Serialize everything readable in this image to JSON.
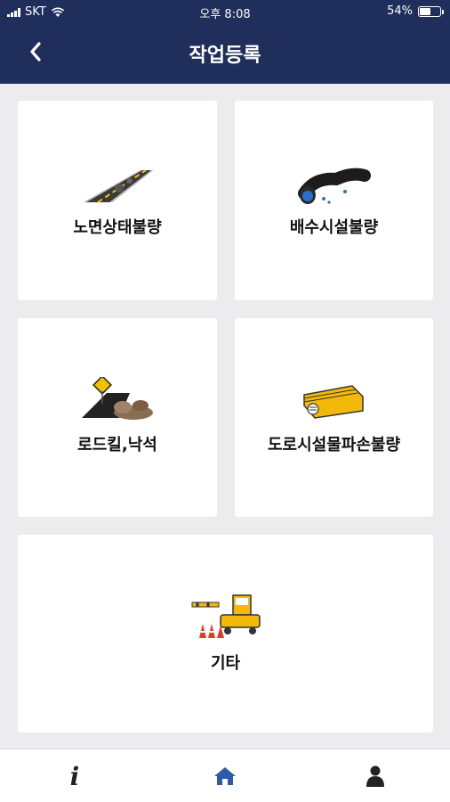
{
  "status": {
    "carrier": "SKT",
    "time": "오후 8:08",
    "battery_text": "54%",
    "battery_level": 0.54
  },
  "header": {
    "title": "작업등록"
  },
  "tiles": [
    {
      "label": "노면상태불량",
      "icon": "road-icon"
    },
    {
      "label": "배수시설불량",
      "icon": "drain-pipe-icon"
    },
    {
      "label": "로드킬,낙석",
      "icon": "falling-rocks-icon"
    },
    {
      "label": "도로시설물파손불량",
      "icon": "guardrail-icon"
    },
    {
      "label": "기타",
      "icon": "roadblock-icon"
    }
  ],
  "tabbar": [
    {
      "icon": "info-icon"
    },
    {
      "icon": "home-icon",
      "active": true
    },
    {
      "icon": "user-icon"
    }
  ],
  "colors": {
    "header": "#1f2e5a",
    "background": "#ececee",
    "tile": "#ffffff",
    "active_tab": "#2f5aa8"
  }
}
